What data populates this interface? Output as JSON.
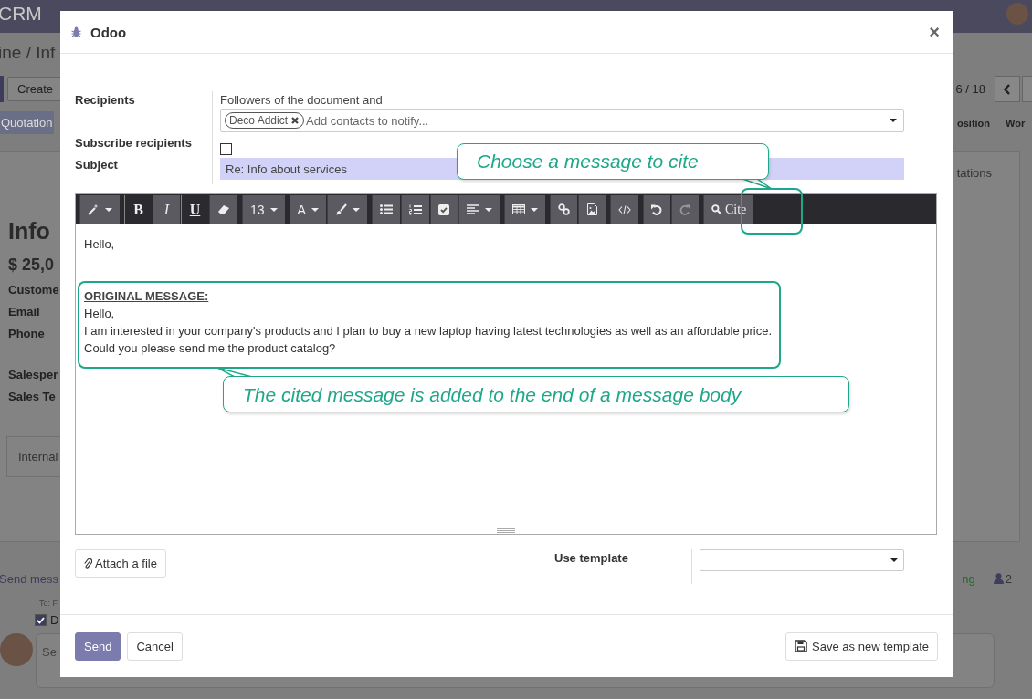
{
  "background_page": {
    "navbar": {
      "app": "CRM"
    },
    "breadcrumb": "ine / Inf",
    "create_button": "Create",
    "pager": "6 / 18",
    "stage_left": "Quotation",
    "stages_right": [
      "osition",
      "Wor"
    ],
    "title": "Info",
    "revenue": "$ 25,0",
    "field_labels": [
      "Custome",
      "Email",
      "Phone",
      "Salesper",
      "Sales Te"
    ],
    "tab_left": "Internal",
    "tab_right": "tations",
    "chatter": {
      "send_message": "Send mess",
      "activity_fragment": "ng",
      "follower_count": "2",
      "to": "To: F",
      "recipient": "D",
      "recipient_checked": true,
      "composer_placeholder": "Se"
    }
  },
  "dialog": {
    "title": "Odoo",
    "close": "×",
    "recipients_label": "Recipients",
    "followers_note": "Followers of the document and",
    "tags": [
      {
        "label": "Deco Addict"
      }
    ],
    "contacts_placeholder": "Add contacts to notify...",
    "subscribe_label": "Subscribe recipients",
    "subscribe_checked": false,
    "subject_label": "Subject",
    "subject": "Re: Info about services",
    "toolbar": [
      {
        "buttons": [
          {
            "kind": "magic",
            "dropdown": true,
            "active": false
          }
        ]
      },
      {
        "buttons": [
          {
            "kind": "bold",
            "label": "B",
            "dropdown": false,
            "active": true
          },
          {
            "kind": "italic",
            "label": "I",
            "dropdown": false,
            "active": false
          },
          {
            "kind": "underline",
            "label": "U",
            "dropdown": false,
            "active": true
          },
          {
            "kind": "eraser",
            "dropdown": false,
            "active": false
          }
        ]
      },
      {
        "buttons": [
          {
            "kind": "text",
            "label": "13",
            "dropdown": true,
            "active": false
          }
        ]
      },
      {
        "buttons": [
          {
            "kind": "text",
            "label": "A",
            "dropdown": true,
            "active": false
          },
          {
            "kind": "brush",
            "dropdown": true,
            "active": false
          }
        ]
      },
      {
        "buttons": [
          {
            "kind": "bullets",
            "dropdown": false,
            "active": false
          },
          {
            "kind": "numbers",
            "dropdown": false,
            "active": false
          },
          {
            "kind": "checklist",
            "dropdown": false,
            "active": false
          },
          {
            "kind": "align",
            "dropdown": true,
            "active": false
          }
        ]
      },
      {
        "buttons": [
          {
            "kind": "table",
            "dropdown": true,
            "active": false
          }
        ]
      },
      {
        "buttons": [
          {
            "kind": "link",
            "dropdown": false,
            "active": false
          },
          {
            "kind": "image",
            "dropdown": false,
            "active": false
          }
        ]
      },
      {
        "buttons": [
          {
            "kind": "code",
            "dropdown": false,
            "active": false
          }
        ]
      },
      {
        "buttons": [
          {
            "kind": "undo",
            "dropdown": false,
            "active": false
          },
          {
            "kind": "redo",
            "dropdown": false,
            "active": false
          }
        ]
      },
      {
        "buttons": [
          {
            "kind": "search",
            "label": "Cite",
            "dropdown": false,
            "active": false
          }
        ]
      }
    ],
    "body": {
      "greeting": "Hello,",
      "quote_heading": "ORIGINAL MESSAGE:",
      "quote_lines": [
        "Hello,",
        "I am interested in your company's products and I plan to buy a new laptop having latest technologies as well as an affordable price.",
        "Could you please send me the product catalog?"
      ]
    },
    "attach_button": "Attach a file",
    "template_label": "Use template",
    "send_button": "Send",
    "cancel_button": "Cancel",
    "save_template_button": "Save as new template"
  },
  "callouts": [
    {
      "text": "Choose a message to cite"
    },
    {
      "text": "The cited message is added to the end of a message body"
    }
  ]
}
